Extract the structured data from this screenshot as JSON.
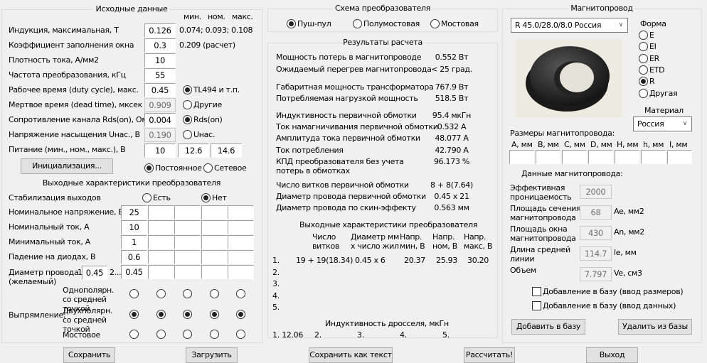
{
  "input": {
    "title": "Исходные данные",
    "col_headers": [
      "мин.",
      "ном.",
      "макс."
    ],
    "rows": [
      {
        "label": "Индукция, максимальная, Т",
        "value": "0.126",
        "note": "0.074; 0.093; 0.108"
      },
      {
        "label": "Коэффициент заполнения окна",
        "value": "0.3",
        "note": "0.209 (расчет)"
      },
      {
        "label": "Плотность тока, А/мм2",
        "value": "10"
      },
      {
        "label": "Частота преобразования, кГц",
        "value": "55"
      },
      {
        "label": "Рабочее время (duty cycle), макс.",
        "value": "0.45",
        "radio": "TL494 и т.п.",
        "checked": true
      },
      {
        "label": "Мертвое время (dead time), мксек",
        "value": "0.909",
        "readonly": true,
        "radio": "Другие",
        "checked": false
      },
      {
        "label": "Сопротивление канала Rds(on), Ом",
        "value": "0.004",
        "radio": "Rds(on)",
        "checked": true
      },
      {
        "label": "Напряжение насыщения Uнас., В",
        "value": "0.190",
        "readonly": true,
        "radio": "Uнас.",
        "checked": false
      }
    ],
    "supply_label": "Питание (мин., ном., макс.), В",
    "supply": [
      "10",
      "12.6",
      "14.6"
    ],
    "init_button": "Инициализация...",
    "supply_type": [
      {
        "label": "Постоянное",
        "checked": true
      },
      {
        "label": "Сетевое",
        "checked": false
      }
    ]
  },
  "output": {
    "title": "Выходные характеристики преобразователя",
    "stab_label": "Стабилизация выходов",
    "stab": [
      {
        "label": "Есть",
        "checked": false
      },
      {
        "label": "Нет",
        "checked": true
      }
    ],
    "rows": [
      {
        "label": "Номинальное напряжение, В",
        "values": [
          "25",
          "",
          "",
          "",
          ""
        ]
      },
      {
        "label": "Номинальный ток, А",
        "values": [
          "10",
          "",
          "",
          "",
          ""
        ]
      },
      {
        "label": "Минимальный ток, А",
        "values": [
          "1",
          "",
          "",
          "",
          ""
        ]
      },
      {
        "label": "Падение на диодах, В",
        "values": [
          "0.6",
          "",
          "",
          "",
          ""
        ]
      }
    ],
    "wire_label": "Диаметр провода",
    "wire_label2": "(желаемый)",
    "wire_1_label": "1",
    "wire_1": "0.45",
    "wire_2_label": "2...",
    "wire_values": [
      "0.45",
      "",
      "",
      "",
      ""
    ],
    "rect_label": "Выпрямление:",
    "rect_types": [
      {
        "label": "Однополярн. со средней точкой",
        "checked": [
          false,
          false,
          false,
          false,
          false
        ]
      },
      {
        "label": "Двухполярн. со средней точкой",
        "checked": [
          true,
          true,
          true,
          true,
          true
        ]
      },
      {
        "label": "Мостовое",
        "checked": [
          false,
          false,
          false,
          false,
          false
        ]
      }
    ]
  },
  "scheme": {
    "title": "Схема преобразователя",
    "options": [
      {
        "label": "Пуш-пул",
        "checked": true
      },
      {
        "label": "Полумостовая",
        "checked": false
      },
      {
        "label": "Мостовая",
        "checked": false
      }
    ]
  },
  "results": {
    "title": "Результаты расчета",
    "rows": [
      {
        "label": "Мощность потерь в магнитопроводе",
        "value": "0.552 Вт"
      },
      {
        "label": "Ожидаемый перегрев магнитопровода",
        "value": "< 25 град."
      },
      {
        "label": "Габаритная мощность трансформатора",
        "value": "767.9 Вт"
      },
      {
        "label": "Потребляемая нагрузкой мощность",
        "value": "518.5 Вт"
      },
      {
        "label": "Индуктивность первичной обмотки",
        "value": "95.4 мкГн"
      },
      {
        "label": "Ток намагничивания первичной обмотки",
        "value": "0.532 А"
      },
      {
        "label": "Амплитуда тока первичной обмотки",
        "value": "48.077 А"
      },
      {
        "label": "Ток потребления",
        "value": "42.790 А"
      },
      {
        "label": "КПД преобразователя без учета",
        "value": "96.173 %"
      },
      {
        "label": "потерь в обмотках",
        "value": ""
      },
      {
        "label": "Число витков первичной обмотки",
        "value": "8 + 8(7.64)"
      },
      {
        "label": "Диаметр провода первичной обмотки",
        "value": "0.45 x 21"
      },
      {
        "label": "Диаметр провода по скин-эффекту",
        "value": "0.563 мм"
      }
    ],
    "out_title": "Выходные характеристики преобразователя",
    "out_headers": [
      [
        "Число",
        "витков"
      ],
      [
        "Диаметр мм",
        "x число жил"
      ],
      [
        "Напр.",
        "мин, В"
      ],
      [
        "Напр.",
        "ном, В"
      ],
      [
        "Напр.",
        "макс, В"
      ]
    ],
    "out_rows": [
      [
        "1.",
        "19 + 19(18.34)",
        "0.45 x 6",
        "20.37",
        "25.93",
        "30.20"
      ],
      [
        "2.",
        "",
        "",
        "",
        "",
        ""
      ],
      [
        "3.",
        "",
        "",
        "",
        "",
        ""
      ],
      [
        "4.",
        "",
        "",
        "",
        "",
        ""
      ],
      [
        "5.",
        "",
        "",
        "",
        "",
        ""
      ]
    ],
    "choke_title": "Индуктивность дросселя, мкГн",
    "choke": [
      "1. 12.06",
      "2.",
      "3.",
      "4.",
      "5."
    ]
  },
  "core": {
    "title": "Магнитопровод",
    "selected": "R 45.0/28.0/8.0 Россия",
    "shape_label": "Форма",
    "shapes": [
      {
        "label": "E",
        "checked": false
      },
      {
        "label": "EI",
        "checked": false
      },
      {
        "label": "ER",
        "checked": false
      },
      {
        "label": "ETD",
        "checked": false
      },
      {
        "label": "R",
        "checked": true
      },
      {
        "label": "Другая",
        "checked": false
      }
    ],
    "material_label": "Материал",
    "material": "Россия",
    "dims_label": "Размеры магнитопровода:",
    "dims": [
      "A, мм",
      "B, мм",
      "C, мм",
      "D, мм",
      "H, мм",
      "h, мм",
      "I, мм"
    ],
    "data_label": "Данные магнитопровода:",
    "params": [
      {
        "label": [
          "Эффективная",
          "проницаемость"
        ],
        "value": "2000",
        "unit": ""
      },
      {
        "label": [
          "Площадь сечения",
          "магнитопровода"
        ],
        "value": "68",
        "unit": "Ae, мм2"
      },
      {
        "label": [
          "Площадь окна",
          "магнитопровода"
        ],
        "value": "430",
        "unit": "An, мм2"
      },
      {
        "label": [
          "Длина средней",
          "линии"
        ],
        "value": "114.7",
        "unit": "le, мм"
      },
      {
        "label": [
          "Объем",
          ""
        ],
        "value": "7.797",
        "unit": "Ve, см3"
      }
    ],
    "checks": [
      {
        "label": "Добавление в базу (ввод размеров)",
        "checked": false
      },
      {
        "label": "Добавление в базу (ввод данных)",
        "checked": false
      }
    ],
    "add_button": "Добавить в базу",
    "delete_button": "Удалить из базы"
  },
  "bottom": {
    "save": "Сохранить",
    "load": "Загрузить",
    "save_text": "Сохранить как текст",
    "calc": "Рассчитать!",
    "exit": "Выход"
  }
}
